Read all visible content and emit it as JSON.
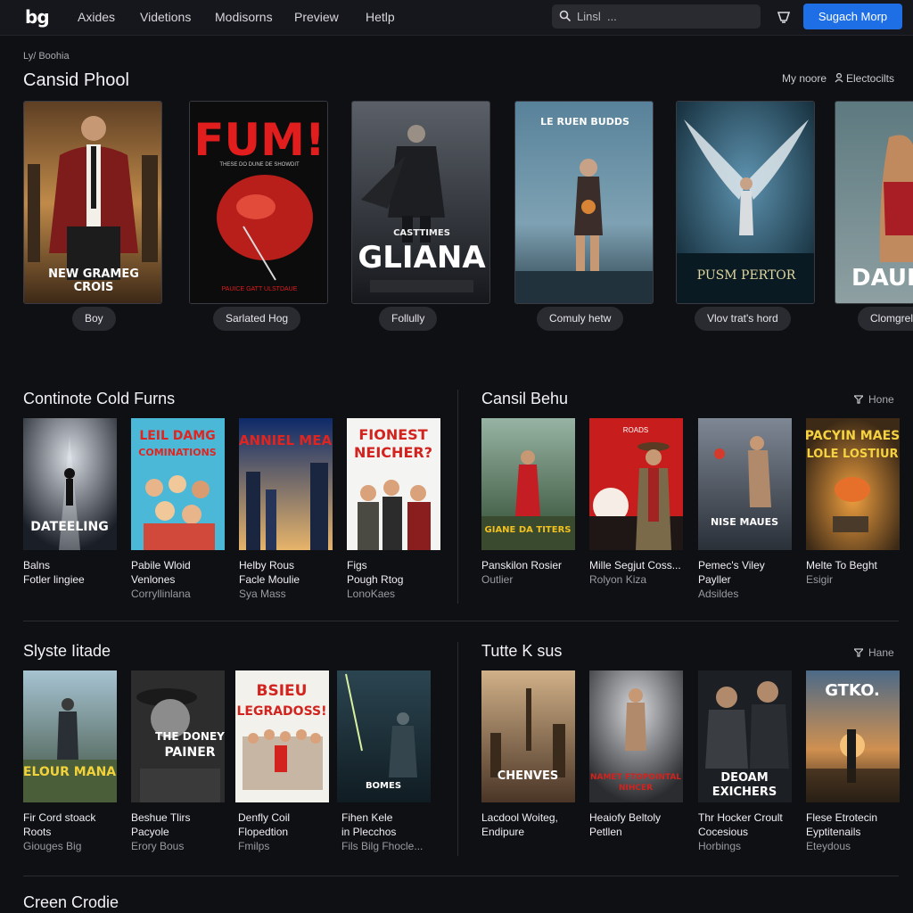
{
  "topbar": {
    "logo": "bg",
    "nav": [
      "Axides",
      "Videtions",
      "Modisorns",
      "Preview",
      "Hetlp"
    ],
    "search_placeholder": "Linsl  ...",
    "cta": "Sugach Morp"
  },
  "hero": {
    "crumb": "Ly/ Boohia",
    "title": "Cansid Phool",
    "meta_more": "My noore",
    "meta_electro": "Electocilts",
    "posters": [
      {
        "title": "NEW GRAMEG CROIS",
        "pill": "Boy",
        "colors": [
          "#5e3f24",
          "#c08a49"
        ]
      },
      {
        "title": "FUM!",
        "subtitle": "THESE DO DUNE DE SHOWDIT",
        "credit": "PAUICE GATT ULSTDAUE",
        "pill": "Sarlated Hog",
        "colors": [
          "#0a0a0a",
          "#2a0d0b"
        ]
      },
      {
        "title": "GLIANA",
        "subtitle": "CASTTIMES",
        "pill": "Follully",
        "colors": [
          "#262a30",
          "#5b6068"
        ]
      },
      {
        "title": "LE RUEN BUDDS",
        "pill": "Comuly hetw",
        "colors": [
          "#58829a",
          "#2a3d4a"
        ]
      },
      {
        "title": "PUSM PERTOR",
        "pill": "Vlov trat's hord",
        "colors": [
          "#0e2531",
          "#2d5a72"
        ]
      },
      {
        "title": "DAUDA",
        "pill": "Clomgrel",
        "colors": [
          "#5d7a80",
          "#8ea0a2"
        ]
      }
    ]
  },
  "section1": {
    "title": "Continote Cold Furns",
    "items": [
      {
        "poster": "DATEELING",
        "l1": "Balns",
        "l2": "Fotler lingiee",
        "l3": "",
        "colors": [
          "#202733",
          "#4d5664"
        ]
      },
      {
        "poster": "LEIL DAMG COMINATIONS",
        "l1": "Pabile Wloid",
        "l2": "Venlones",
        "l3": "Corryllinlana",
        "colors": [
          "#2aa3c9",
          "#6fd1e8"
        ]
      },
      {
        "poster": "ANNIEL MEA",
        "l1": "Helby Rous",
        "l2": "Facle Moulie",
        "l3": "Sya Mass",
        "colors": [
          "#1b3880",
          "#6b8fd0"
        ]
      },
      {
        "poster": "FIONEST NEICHER?",
        "l1": "Figs",
        "l2": "Pough Rtog",
        "l3": "LonoKaes",
        "colors": [
          "#f4f4f2",
          "#d8d8d4"
        ]
      }
    ]
  },
  "section2": {
    "title": "Cansil Behu",
    "filter": "Hone",
    "items": [
      {
        "poster": "GIANE DA TITERS",
        "l1": "Panskilon Rosier",
        "l2": "Outlier",
        "l3": "",
        "colors": [
          "#5e8a5a",
          "#2e4a30"
        ]
      },
      {
        "poster": "ROADS",
        "l1": "Mille Segjut Coss...",
        "l2": "Rolyon Kiza",
        "l3": "",
        "colors": [
          "#c81d1d",
          "#1f1616"
        ]
      },
      {
        "poster": "NISE MAUES",
        "l1": "Pemec's Viley",
        "l2": "Payller",
        "l3": "Adsildes",
        "colors": [
          "#3c4450",
          "#7e8794"
        ]
      },
      {
        "poster": "PACYIN MAES LOLE LOSTIUR",
        "l1": "Melte To Beght",
        "l2": "Esigir",
        "l3": "",
        "colors": [
          "#a7651e",
          "#3d2a16"
        ]
      }
    ]
  },
  "section3": {
    "title": "Slyste Iitade",
    "items": [
      {
        "poster": "ELOUR MANA",
        "l1": "Fir Cord stoack",
        "l2": "Roots",
        "l3": "Giouges Big",
        "colors": [
          "#6d8a9b",
          "#3b4d3a"
        ]
      },
      {
        "poster": "THE DONEY PAINER",
        "l1": "Beshue Tlirs",
        "l2": "Pacyole",
        "l3": "Erory Bous",
        "colors": [
          "#2d2d2d",
          "#8c8c8c"
        ]
      },
      {
        "poster": "BSIEU LEGRADOSS!",
        "l1": "Denfly Coil",
        "l2": "Flopedtion",
        "l3": "Fmilps",
        "colors": [
          "#f3f1ec",
          "#d6d2c8"
        ]
      },
      {
        "poster": "BOMES",
        "l1": "Fihen Kele",
        "l2": "in Plecchos",
        "l3": "Fils Bilg Fhocle...",
        "colors": [
          "#101c22",
          "#2b4550"
        ]
      }
    ]
  },
  "section4": {
    "title": "Tutte K sus",
    "filter": "Hane",
    "items": [
      {
        "poster": "CHENVES",
        "l1": "Lacdool Woiteg,",
        "l2": "Endipure",
        "l3": "",
        "colors": [
          "#b08860",
          "#4a3526"
        ]
      },
      {
        "poster": "NAMET FTOPOINTAL NIHCER",
        "l1": "Heaiofy Beltoly",
        "l2": "Petllen",
        "l3": "",
        "colors": [
          "#7c7e84",
          "#2b2c30"
        ]
      },
      {
        "poster": "DEOAM EXICHERS",
        "l1": "Thr Hocker Croult",
        "l2": "Cocesious",
        "l3": "Horbings",
        "colors": [
          "#1c1f24",
          "#5a5e64"
        ]
      },
      {
        "poster": "GTKO.",
        "l1": "Flese Etrotecin",
        "l2": "Eyptitenails",
        "l3": "Eteydous",
        "colors": [
          "#d09050",
          "#4c6a88"
        ]
      }
    ]
  },
  "section5": {
    "title": "Creen Crodie"
  }
}
